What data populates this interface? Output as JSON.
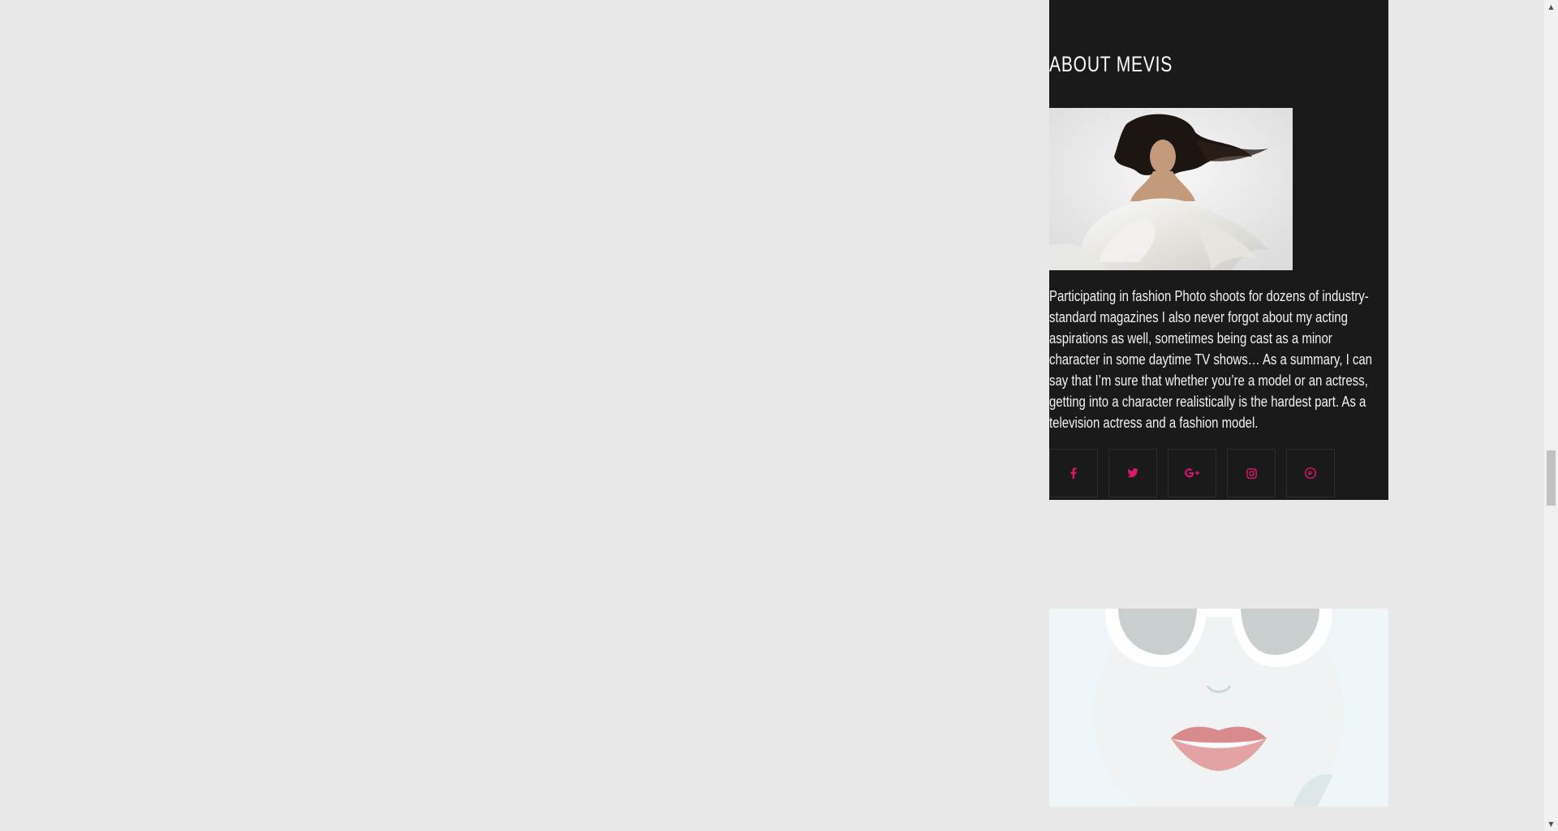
{
  "about": {
    "title": "ABOUT MEVIS",
    "description": "Participating in fashion Photo shoots for dozens of industry-standard magazines I also never forgot about my acting aspirations as well, sometimes being cast as a minor character in some daytime TV shows…  As a summary, I can say that I’m sure that whether you’re a model or an actress, getting into a character realistically is the hardest part. As a television actress and a fashion model.",
    "social": [
      {
        "icon": "facebook-icon"
      },
      {
        "icon": "twitter-icon"
      },
      {
        "icon": "google-plus-icon"
      },
      {
        "icon": "instagram-icon"
      },
      {
        "icon": "pinterest-icon"
      }
    ]
  },
  "colors": {
    "page_bg": "#e8e8e8",
    "widget_bg": "#1a1a1a",
    "accent": "#e0156e"
  },
  "scrollbar": {
    "up_glyph": "▲",
    "down_glyph": "▼"
  }
}
